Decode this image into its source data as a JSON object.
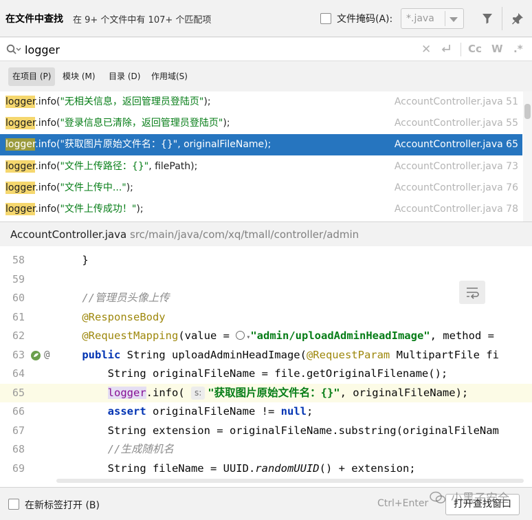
{
  "dialog": {
    "title": "在文件中查找",
    "summary": "在 9+ 个文件中有 107+ 个匹配项",
    "file_mask_label": "文件掩码(A):",
    "file_mask_value": "*.java"
  },
  "search": {
    "query": "logger",
    "options": {
      "match_case": "Cc",
      "words": "W",
      "regex": ".*"
    }
  },
  "scopes": [
    {
      "label": "在项目 (P)",
      "active": true
    },
    {
      "label": "模块 (M)",
      "active": false
    },
    {
      "label": "目录 (D)",
      "active": false
    },
    {
      "label": "作用域(S)",
      "active": false
    }
  ],
  "results": [
    {
      "match": "logger",
      "pre": ".info(",
      "str": "\"无相关信息，返回管理员登陆页\"",
      "post": ");",
      "file": "AccountController.java 51",
      "selected": false
    },
    {
      "match": "logger",
      "pre": ".info(",
      "str": "\"登录信息已清除，返回管理员登陆页\"",
      "post": ");",
      "file": "AccountController.java 55",
      "selected": false
    },
    {
      "match": "logger",
      "pre": ".info(",
      "str": "\"获取图片原始文件名：{}\"",
      "post": ", originalFileName);",
      "file": "AccountController.java 65",
      "selected": true
    },
    {
      "match": "logger",
      "pre": ".info(",
      "str": "\"文件上传路径：{}\"",
      "post": ", filePath);",
      "file": "AccountController.java 73",
      "selected": false
    },
    {
      "match": "logger",
      "pre": ".info(",
      "str": "\"文件上传中...\"",
      "post": ");",
      "file": "AccountController.java 76",
      "selected": false
    },
    {
      "match": "logger",
      "pre": ".info(",
      "str": "\"文件上传成功！\"",
      "post": ");",
      "file": "AccountController.java 78",
      "selected": false
    }
  ],
  "preview": {
    "file_name": "AccountController.java",
    "file_path": "src/main/java/com/xq/tmall/controller/admin",
    "current_line": 65,
    "lines": [
      {
        "num": "58",
        "code": "    }"
      },
      {
        "num": "59",
        "code": ""
      },
      {
        "num": "60",
        "code": "    //管理员头像上传"
      },
      {
        "num": "61",
        "code": "    @ResponseBody"
      },
      {
        "num": "62",
        "code": "    @RequestMapping(value = \"admin/uploadAdminHeadImage\", method ="
      },
      {
        "num": "63",
        "code": "    public String uploadAdminHeadImage(@RequestParam MultipartFile fi"
      },
      {
        "num": "64",
        "code": "        String originalFileName = file.getOriginalFilename();"
      },
      {
        "num": "65",
        "code": "        logger.info( s: \"获取图片原始文件名：{}\", originalFileName);"
      },
      {
        "num": "66",
        "code": "        assert originalFileName != null;"
      },
      {
        "num": "67",
        "code": "        String extension = originalFileName.substring(originalFileNam"
      },
      {
        "num": "68",
        "code": "        //生成随机名"
      },
      {
        "num": "69",
        "code": "        String fileName = UUID.randomUUID() + extension;"
      }
    ],
    "hint_label": "s:"
  },
  "footer": {
    "new_tab_label": "在新标签打开 (B)",
    "shortcut": "Ctrl+Enter",
    "open_button": "打开查找窗口"
  },
  "watermark": "小黑子安全",
  "icons": {
    "filter": "filter-icon",
    "pin": "pin-icon",
    "search": "search-icon",
    "clear": "clear-icon",
    "newline": "newline-icon"
  }
}
